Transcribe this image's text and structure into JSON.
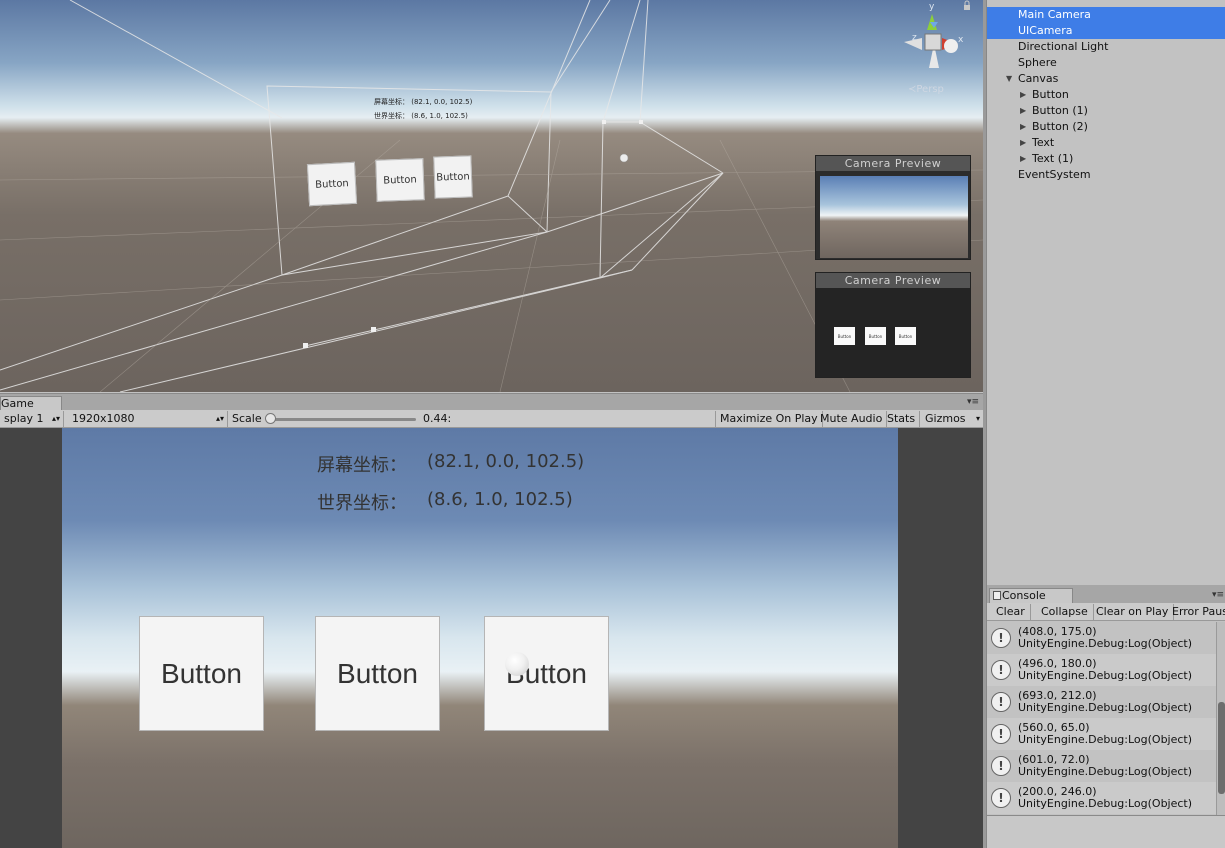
{
  "scene": {
    "persp_label": "≺Persp",
    "canvas_text_1": "屏幕坐标：   (82.1, 0.0, 102.5)",
    "canvas_text_2": "世界坐标：   (8.6, 1.0, 102.5)",
    "buttons": [
      "Button",
      "Button",
      "Button"
    ],
    "previews": [
      {
        "title": "Camera Preview"
      },
      {
        "title": "Camera Preview",
        "buttons": [
          "Button",
          "Button",
          "Button"
        ]
      }
    ],
    "gizmo": {
      "y": "y",
      "x": "x",
      "z": "z"
    }
  },
  "game": {
    "tab_label": "Game",
    "display": "splay 1",
    "resolution": "1920x1080",
    "scale_label": "Scale",
    "scale_value": "0.44:",
    "scale_fraction": 0.44,
    "maximize_on_play": "Maximize On Play",
    "mute_audio": "Mute Audio",
    "stats": "Stats",
    "gizmos": "Gizmos",
    "screen_coord_label": "屏幕坐标：",
    "screen_coord_value": "(82.1, 0.0, 102.5)",
    "world_coord_label": "世界坐标：",
    "world_coord_value": "(8.6, 1.0, 102.5)",
    "buttons": [
      "Button",
      "Button",
      "Button"
    ]
  },
  "hierarchy": {
    "items": [
      {
        "label": "Main Camera",
        "selected": true
      },
      {
        "label": "UICamera",
        "selected": true
      },
      {
        "label": "Directional Light"
      },
      {
        "label": "Sphere"
      },
      {
        "label": "Canvas",
        "expanded": true
      },
      {
        "label": "Button",
        "collapsed": true
      },
      {
        "label": "Button (1)",
        "collapsed": true
      },
      {
        "label": "Button (2)",
        "collapsed": true
      },
      {
        "label": "Text",
        "collapsed": true
      },
      {
        "label": "Text (1)",
        "collapsed": true
      },
      {
        "label": "EventSystem"
      }
    ]
  },
  "console": {
    "tab_label": "Console",
    "toolbar": {
      "clear": "Clear",
      "collapse": "Collapse",
      "clear_on_play": "Clear on Play",
      "error_pause": "Error Paus"
    },
    "logs": [
      {
        "line1": "(408.0, 175.0)",
        "line2": "UnityEngine.Debug:Log(Object)"
      },
      {
        "line1": "(496.0, 180.0)",
        "line2": "UnityEngine.Debug:Log(Object)"
      },
      {
        "line1": "(693.0, 212.0)",
        "line2": "UnityEngine.Debug:Log(Object)"
      },
      {
        "line1": "(560.0, 65.0)",
        "line2": "UnityEngine.Debug:Log(Object)"
      },
      {
        "line1": "(601.0, 72.0)",
        "line2": "UnityEngine.Debug:Log(Object)"
      },
      {
        "line1": "(200.0, 246.0)",
        "line2": "UnityEngine.Debug:Log(Object)"
      }
    ]
  }
}
